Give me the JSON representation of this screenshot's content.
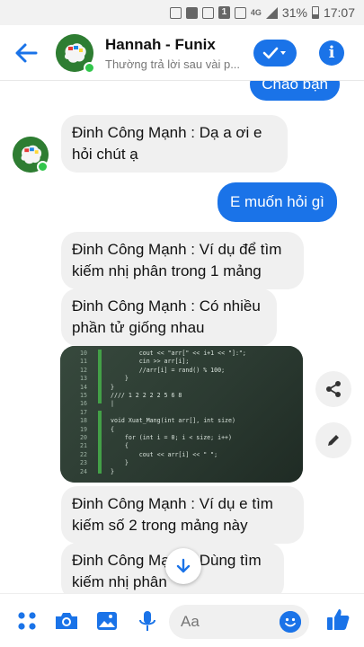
{
  "status_bar": {
    "network": "4G",
    "notification_count": "1",
    "battery": "31%",
    "time": "17:07"
  },
  "header": {
    "name": "Hannah - Funix",
    "subtitle": "Thường trả lời sau vài p..."
  },
  "messages": [
    {
      "from": "me",
      "text": "Chào bạn"
    },
    {
      "from": "them",
      "text": "Đinh Công Mạnh : Dạ a ơi e hỏi chút ạ"
    },
    {
      "from": "me",
      "text": "E muốn hỏi gì"
    },
    {
      "from": "them",
      "text": "Đinh Công Mạnh : Ví dụ để tìm kiếm nhị phân trong 1 mảng"
    },
    {
      "from": "them",
      "text": "Đinh Công Mạnh : Có nhiều phần tử giống nhau"
    },
    {
      "from": "them",
      "text": "Đinh Công Mạnh : Ví dụ e tìm kiếm số 2 trong mảng này"
    },
    {
      "from": "them",
      "text": "Đinh Công Mạnh : Dùng tìm kiếm nhị phân"
    }
  ],
  "code_image": {
    "line_numbers": [
      "10",
      "11",
      "12",
      "13",
      "14",
      "15",
      "16",
      "17",
      "18",
      "19",
      "20",
      "21",
      "22",
      "23",
      "24"
    ],
    "lines": [
      "        cout << \"arr[\" << i+1 << \"]:\";",
      "        cin >> arr[i];",
      "        //arr[i] = rand() % 100;",
      "    }",
      "}",
      "//// 1 2 2 2 2 5 6 8",
      "|",
      "",
      "void Xuat_Mang(int arr[], int size)",
      "{",
      "    for (int i = 0; i < size; i++)",
      "    {",
      "        cout << arr[i] << \" \";",
      "    }",
      "}"
    ]
  },
  "composer": {
    "placeholder": "Aa"
  },
  "colors": {
    "accent": "#1a73e8",
    "incoming_bubble": "#f0f0f0",
    "online": "#31c64b"
  }
}
